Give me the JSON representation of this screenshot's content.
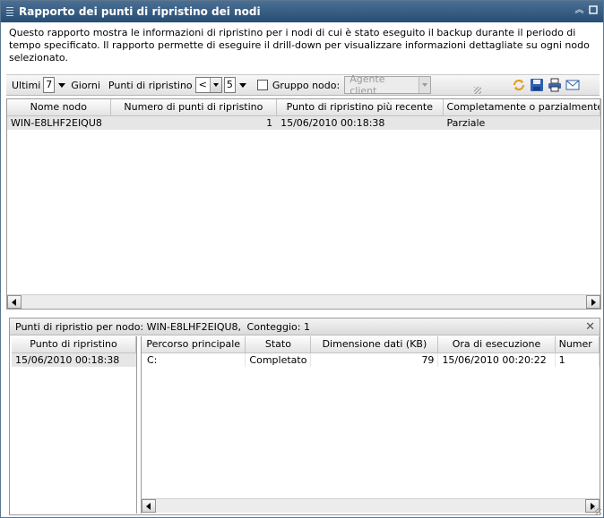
{
  "window": {
    "title": "Rapporto dei punti di ripristino dei nodi"
  },
  "description": "Questo rapporto mostra le informazioni di ripristino per i nodi di cui è stato eseguito il backup durante il periodo di tempo specificato. Il rapporto permette di eseguire il drill-down per visualizzare informazioni dettagliate su ogni nodo selezionato.",
  "toolbar": {
    "last_label": "Ultimi",
    "last_value": "7",
    "days_label": "Giorni",
    "points_label": "Punti di ripristino",
    "operator_value": "<",
    "points_value": "5",
    "group_label": "Gruppo nodo:",
    "group_value": "Agente client"
  },
  "main_table": {
    "columns": [
      "Nome nodo",
      "Numero di punti di ripristino",
      "Punto di ripristino più recente",
      "Completamente o parzialmente"
    ],
    "rows": [
      {
        "node": "WIN-E8LHF2EIQU8",
        "count": "1",
        "latest": "15/06/2010 00:18:38",
        "status": "Parziale"
      }
    ]
  },
  "detail": {
    "header_prefix": "Punti di ripristio per nodo:",
    "header_node": "WIN-E8LHF2EIQU8,",
    "header_count_label": "Conteggio:",
    "header_count": "1",
    "left_column": "Punto di ripristino",
    "left_rows": [
      "15/06/2010 00:18:38"
    ],
    "columns": [
      "Percorso principale",
      "Stato",
      "Dimensione dati (KB)",
      "Ora di esecuzione",
      "Numer"
    ],
    "rows": [
      {
        "path": "C:",
        "state": "Completato",
        "size": "79",
        "time": "15/06/2010 00:20:22",
        "num": "1"
      }
    ]
  },
  "colors": {
    "title_bar": "#264d73",
    "selected_row": "#e6e6e6"
  }
}
